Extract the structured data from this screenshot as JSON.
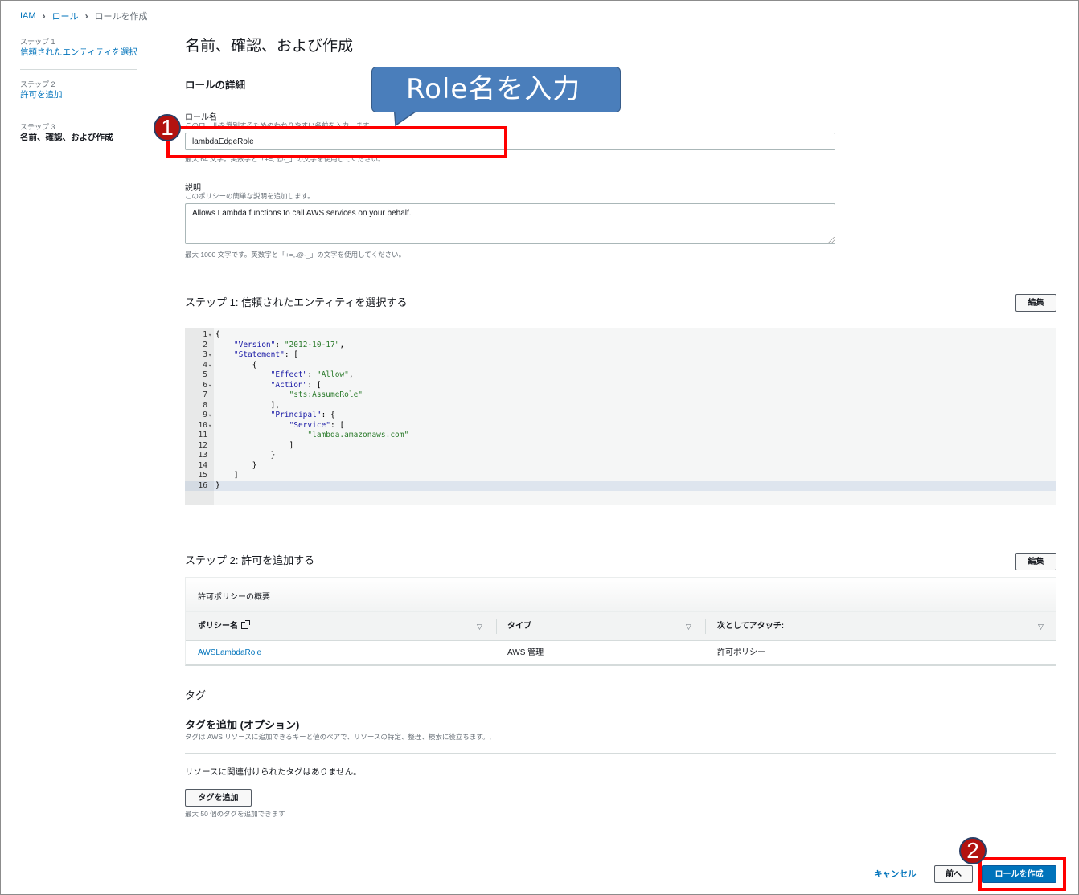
{
  "breadcrumb": {
    "items": [
      "IAM",
      "ロール"
    ],
    "current": "ロールを作成"
  },
  "steps": [
    {
      "num": "ステップ 1",
      "name": "信頼されたエンティティを選択"
    },
    {
      "num": "ステップ 2",
      "name": "許可を追加"
    },
    {
      "num": "ステップ 3",
      "name": "名前、確認、および作成"
    }
  ],
  "page_title": "名前、確認、および作成",
  "role_details": {
    "title": "ロールの詳細",
    "name_label": "ロール名",
    "name_desc": "このロールを識別するためのわかりやすい名前を入力します。",
    "name_value": "lambdaEdgeRole",
    "name_hint": "最大 64 文字。英数字と「+=,.@-_」の文字を使用してください。",
    "desc_label": "説明",
    "desc_desc": "このポリシーの簡単な説明を追加します。",
    "desc_value": "Allows Lambda functions to call AWS services on your behalf.",
    "desc_hint": "最大 1000 文字です。英数字と「+=,.@-_」の文字を使用してください。"
  },
  "step1": {
    "title": "ステップ 1: 信頼されたエンティティを選択する",
    "edit_label": "編集",
    "code_lines": [
      {
        "n": "1",
        "fold": true,
        "text": "{"
      },
      {
        "n": "2",
        "fold": false,
        "text": "    \"Version\": \"2012-10-17\","
      },
      {
        "n": "3",
        "fold": true,
        "text": "    \"Statement\": ["
      },
      {
        "n": "4",
        "fold": true,
        "text": "        {"
      },
      {
        "n": "5",
        "fold": false,
        "text": "            \"Effect\": \"Allow\","
      },
      {
        "n": "6",
        "fold": true,
        "text": "            \"Action\": ["
      },
      {
        "n": "7",
        "fold": false,
        "text": "                \"sts:AssumeRole\""
      },
      {
        "n": "8",
        "fold": false,
        "text": "            ],"
      },
      {
        "n": "9",
        "fold": true,
        "text": "            \"Principal\": {"
      },
      {
        "n": "10",
        "fold": true,
        "text": "                \"Service\": ["
      },
      {
        "n": "11",
        "fold": false,
        "text": "                    \"lambda.amazonaws.com\""
      },
      {
        "n": "12",
        "fold": false,
        "text": "                ]"
      },
      {
        "n": "13",
        "fold": false,
        "text": "            }"
      },
      {
        "n": "14",
        "fold": false,
        "text": "        }"
      },
      {
        "n": "15",
        "fold": false,
        "text": "    ]"
      },
      {
        "n": "16",
        "fold": false,
        "text": "}"
      }
    ],
    "highlight_line": "16"
  },
  "step2": {
    "title": "ステップ 2: 許可を追加する",
    "edit_label": "編集",
    "table_title": "許可ポリシーの概要",
    "columns": [
      "ポリシー名",
      "タイプ",
      "次としてアタッチ:"
    ],
    "rows": [
      {
        "policy": "AWSLambdaRole",
        "type": "AWS 管理",
        "attached_as": "許可ポリシー"
      }
    ]
  },
  "tags": {
    "heading": "タグ",
    "add_title": "タグを追加 (オプション)",
    "add_desc": "タグは AWS リソースに追加できるキーと値のペアで、リソースの特定、整理、検索に役立ちます。,",
    "empty": "リソースに関連付けられたタグはありません。",
    "add_button": "タグを追加",
    "limit": "最大 50 個のタグを追加できます"
  },
  "footer": {
    "cancel": "キャンセル",
    "previous": "前へ",
    "create": "ロールを作成"
  },
  "annotations": {
    "callout": "Role名を入力",
    "badge1": "1",
    "badge2": "2"
  },
  "colors": {
    "link": "#0073bb",
    "primary_button": "#0073bb",
    "annotation_red": "#ff0000",
    "callout_blue": "#4a7ebb"
  }
}
